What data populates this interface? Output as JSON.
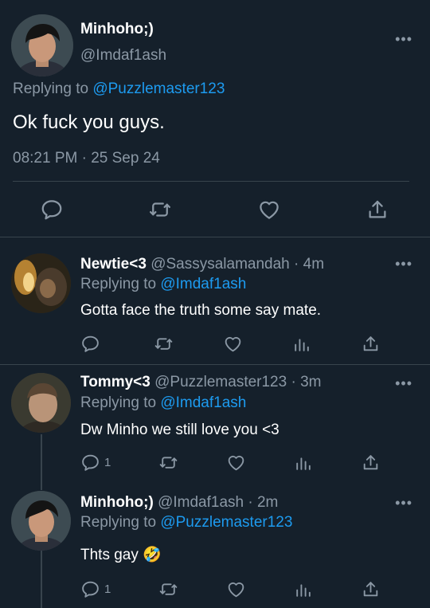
{
  "main_tweet": {
    "display_name": "Minhoho;)",
    "handle": "@Imdaf1ash",
    "replying_prefix": "Replying to",
    "replying_to": "@Puzzlemaster123",
    "text": "Ok fuck you guys.",
    "timestamp": "08:21 PM · 25 Sep 24",
    "more": "•••"
  },
  "replies": [
    {
      "display_name": "Newtie<3",
      "handle": "@Sassysalamandah",
      "time": "· 4m",
      "replying_prefix": "Replying to",
      "replying_to": "@Imdaf1ash",
      "text": "Gotta face the truth some say mate.",
      "reply_count": "",
      "more": "•••"
    },
    {
      "display_name": "Tommy<3",
      "handle": "@Puzzlemaster123",
      "time": "· 3m",
      "replying_prefix": "Replying to",
      "replying_to": "@Imdaf1ash",
      "text": "Dw Minho we still love you <3",
      "reply_count": "1",
      "more": "•••"
    },
    {
      "display_name": "Minhoho;)",
      "handle": "@Imdaf1ash",
      "time": "· 2m",
      "replying_prefix": "Replying to",
      "replying_to": "@Puzzlemaster123",
      "text": "Thts gay",
      "emoji": "🤣",
      "reply_count": "1",
      "more": "•••"
    }
  ],
  "colors": {
    "background": "#15202b",
    "text": "#ffffff",
    "muted": "#8b98a5",
    "link": "#1d9bf0",
    "divider": "#38444d"
  },
  "icons": [
    "reply-icon",
    "retweet-icon",
    "like-icon",
    "views-icon",
    "share-icon",
    "more-icon"
  ]
}
